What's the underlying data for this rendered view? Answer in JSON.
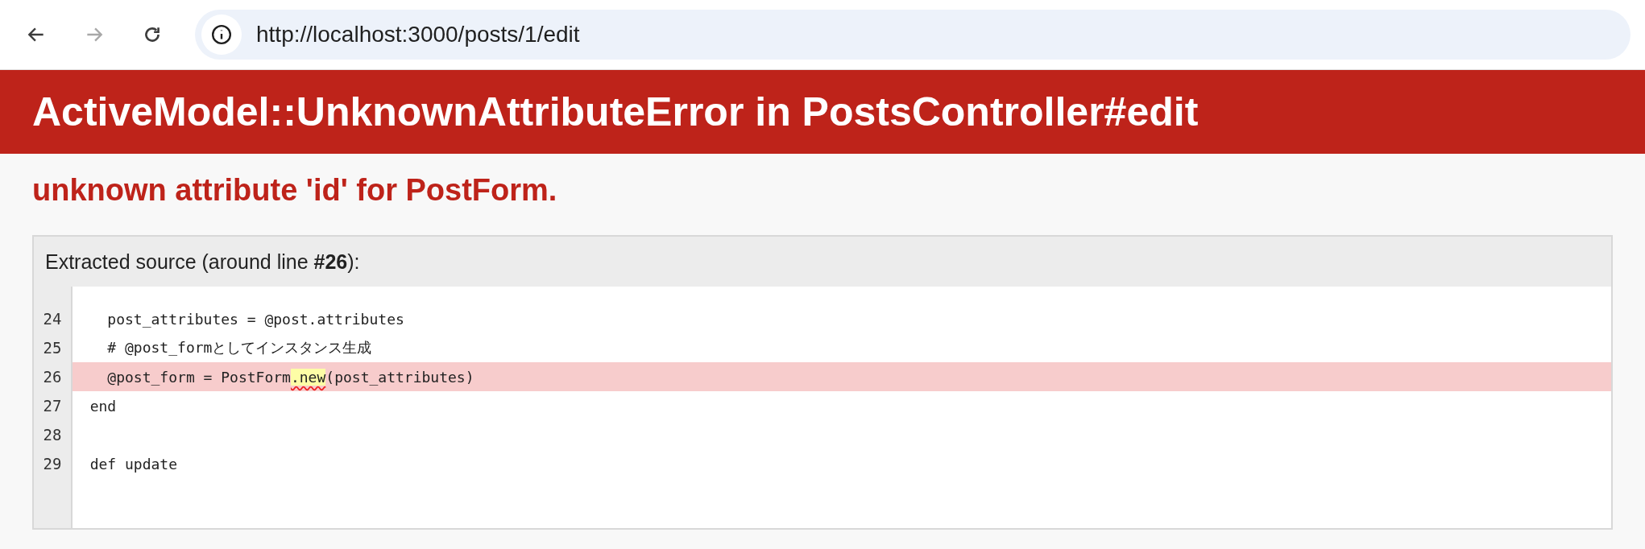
{
  "browser": {
    "back_disabled": false,
    "forward_disabled": true,
    "url": "http://localhost:3000/posts/1/edit"
  },
  "error": {
    "title": "ActiveModel::UnknownAttributeError in PostsController#edit",
    "message": "unknown attribute 'id' for PostForm."
  },
  "source": {
    "heading": "Extracted source (around line **#26**):",
    "lines": [
      {
        "number": "24",
        "selected": false,
        "parts": [
          {
            "kind": "plain",
            "text": "    post_attributes = @post.attributes"
          }
        ]
      },
      {
        "number": "25",
        "selected": false,
        "parts": [
          {
            "kind": "plain",
            "text": "    # @post_formとしてインスタンス生成"
          }
        ]
      },
      {
        "number": "26",
        "selected": true,
        "parts": [
          {
            "kind": "plain",
            "text": "    @post_form = PostForm"
          },
          {
            "kind": "error",
            "text": ".new"
          },
          {
            "kind": "plain",
            "text": "(post_attributes)"
          }
        ]
      },
      {
        "number": "27",
        "selected": false,
        "parts": [
          {
            "kind": "plain",
            "text": "  end"
          }
        ]
      },
      {
        "number": "28",
        "selected": false
      },
      {
        "number": "29",
        "selected": false,
        "parts": [
          {
            "kind": "plain",
            "text": "  def update"
          }
        ]
      }
    ]
  }
}
